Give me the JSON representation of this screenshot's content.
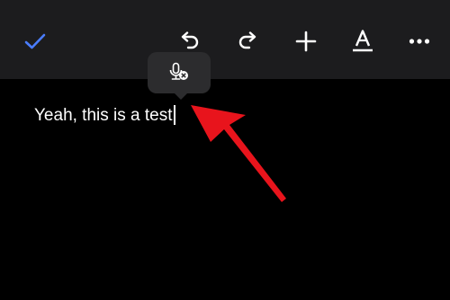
{
  "toolbar": {
    "done_icon": "checkmark-icon",
    "undo_icon": "undo-icon",
    "redo_icon": "redo-icon",
    "add_icon": "plus-icon",
    "format_icon": "text-format-icon",
    "more_icon": "ellipsis-icon",
    "accent_color": "#4a7dff"
  },
  "dictation_popup": {
    "icon": "microphone-stop-icon"
  },
  "editor": {
    "text": "Yeah, this is a test"
  },
  "annotation": {
    "arrow_color": "#e8141c"
  }
}
